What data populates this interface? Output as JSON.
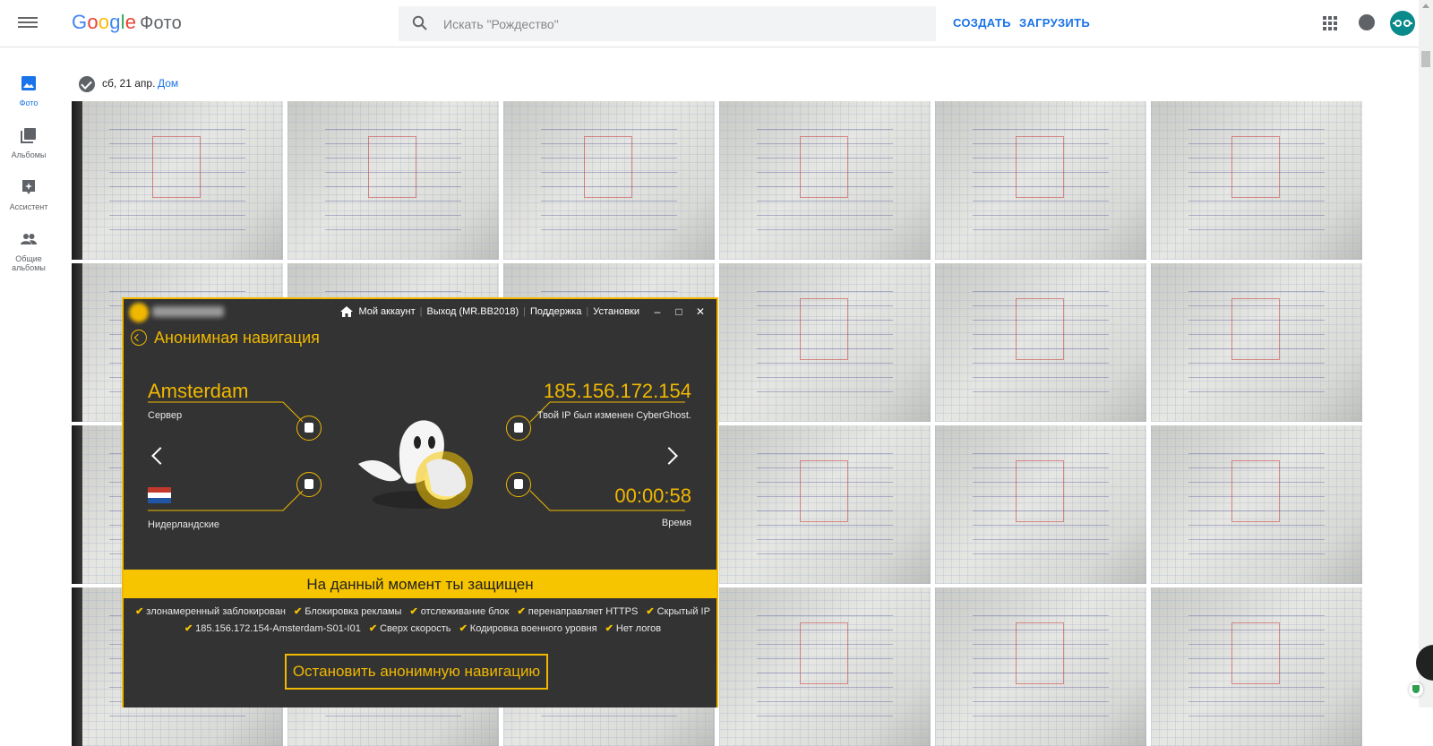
{
  "app": {
    "logo_word": [
      "G",
      "o",
      "o",
      "g",
      "l",
      "e"
    ],
    "product": "Фото"
  },
  "search": {
    "placeholder": "Искать \"Рождество\""
  },
  "header": {
    "create_label": "СОЗДАТЬ",
    "upload_label": "ЗАГРУЗИТЬ"
  },
  "leftnav": [
    {
      "label": "Фото",
      "icon": "photo-icon",
      "active": true
    },
    {
      "label": "Альбомы",
      "icon": "albums-icon",
      "active": false
    },
    {
      "label": "Ассистент",
      "icon": "assistant-icon",
      "active": false
    },
    {
      "label": "Общие альбомы",
      "icon": "shared-albums-icon",
      "active": false
    }
  ],
  "date_group": {
    "date": "сб, 21 апр.",
    "location": "Дом"
  },
  "photos_count": 24,
  "cyberghost": {
    "nav": {
      "account": "Мой аккаунт",
      "logout": "Выход (MR.BB2018)",
      "support": "Поддержка",
      "settings": "Установки"
    },
    "window_controls": [
      "–",
      "□",
      "✕"
    ],
    "title": "Анонимная навигация",
    "city": "Amsterdam",
    "server_label": "Сервер",
    "ip": "185.156.172.154",
    "ip_label": "Твой IP был изменен CyberGhost.",
    "country": "Нидерландские",
    "time": "00:00:58",
    "time_label": "Время",
    "status": "На данный момент ты защищен",
    "features_line1": [
      "злонамеренный заблокирован",
      "Блокировка рекламы",
      "отслеживание блок",
      "перенаправляет HTTPS",
      "Скрытый IP"
    ],
    "features_line2": [
      "185.156.172.154-Amsterdam-S01-I01",
      "Сверх скорость",
      "Кодировка военного уровня",
      "Нет логов"
    ],
    "stop_button": "Остановить анонимную навигацию"
  },
  "colors": {
    "google_blue": "#1a73e8",
    "cg_yellow": "#f0b800",
    "cg_status_bg": "#f6c500",
    "cg_bg": "#333333"
  }
}
